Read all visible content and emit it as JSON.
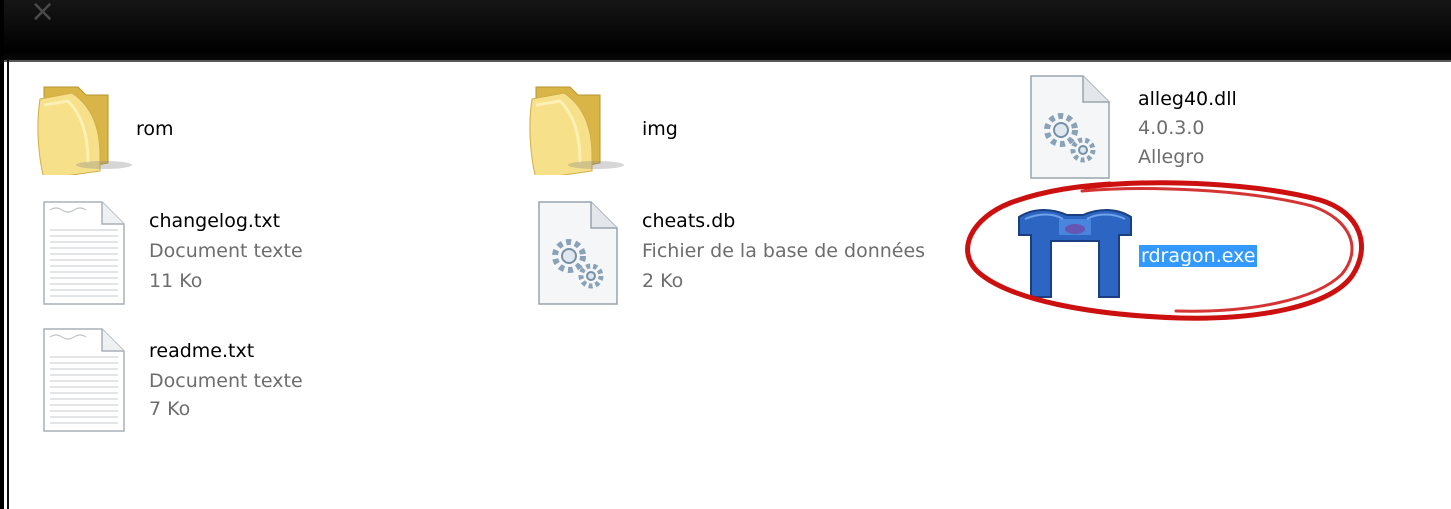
{
  "window": {
    "close_glyph": "×"
  },
  "files": [
    {
      "name": "rom",
      "type": "folder-icon"
    },
    {
      "name": "img",
      "type": "folder-icon"
    },
    {
      "name": "alleg40.dll",
      "version": "4.0.3.0",
      "company": "Allegro",
      "type": "dll-icon"
    },
    {
      "name": "changelog.txt",
      "type_desc": "Document texte",
      "size": "11 Ko"
    },
    {
      "name": "cheats.db",
      "type_desc": "Fichier de la base de données",
      "size": "2 Ko"
    },
    {
      "name": "rdragon.exe",
      "selected": true
    },
    {
      "name": "readme.txt",
      "type_desc": "Document texte",
      "size": "7 Ko"
    }
  ],
  "colors": {
    "selection": "#3399ff",
    "annotation": "#cc1010",
    "folder": "#f0d46a",
    "exe_icon": "#2d66c2"
  }
}
